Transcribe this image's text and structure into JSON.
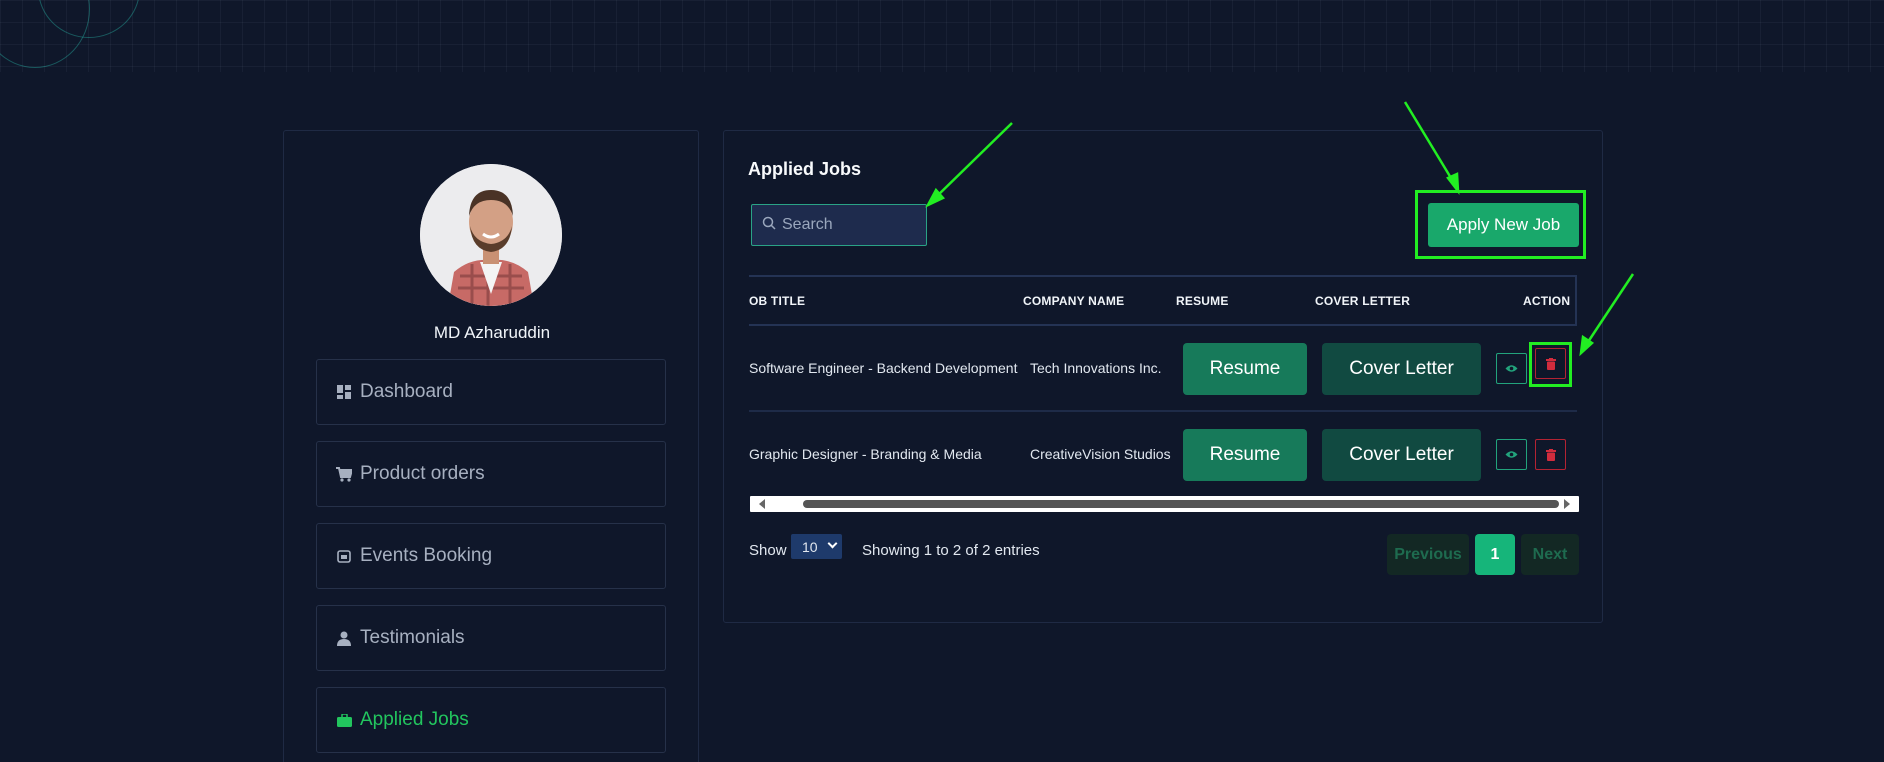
{
  "profile": {
    "name": "MD Azharuddin"
  },
  "sidebar": {
    "items": [
      {
        "label": "Dashboard",
        "icon": "dashboard-icon"
      },
      {
        "label": "Product orders",
        "icon": "cart-icon"
      },
      {
        "label": "Events Booking",
        "icon": "calendar-icon"
      },
      {
        "label": "Testimonials",
        "icon": "user-icon"
      },
      {
        "label": "Applied Jobs",
        "icon": "briefcase-icon",
        "active": true
      }
    ]
  },
  "main": {
    "title": "Applied Jobs",
    "search": {
      "placeholder": "Search",
      "value": ""
    },
    "apply_button": "Apply New Job",
    "table": {
      "headers": [
        "OB TITLE",
        "COMPANY NAME",
        "RESUME",
        "COVER LETTER",
        "ACTION"
      ],
      "rows": [
        {
          "job_title": "Software Engineer - Backend Development",
          "company": "Tech Innovations Inc.",
          "resume": "Resume",
          "cover_letter": "Cover Letter"
        },
        {
          "job_title": "Graphic Designer - Branding & Media",
          "company": "CreativeVision Studios",
          "resume": "Resume",
          "cover_letter": "Cover Letter"
        }
      ]
    },
    "footer": {
      "show_label": "Show",
      "page_length": "10",
      "info": "Showing 1 to 2 of 2 entries",
      "previous": "Previous",
      "page": "1",
      "next": "Next"
    }
  },
  "colors": {
    "background": "#0f172a",
    "accent": "#19a86b",
    "annotation": "#22ee22",
    "danger": "#b42333"
  }
}
